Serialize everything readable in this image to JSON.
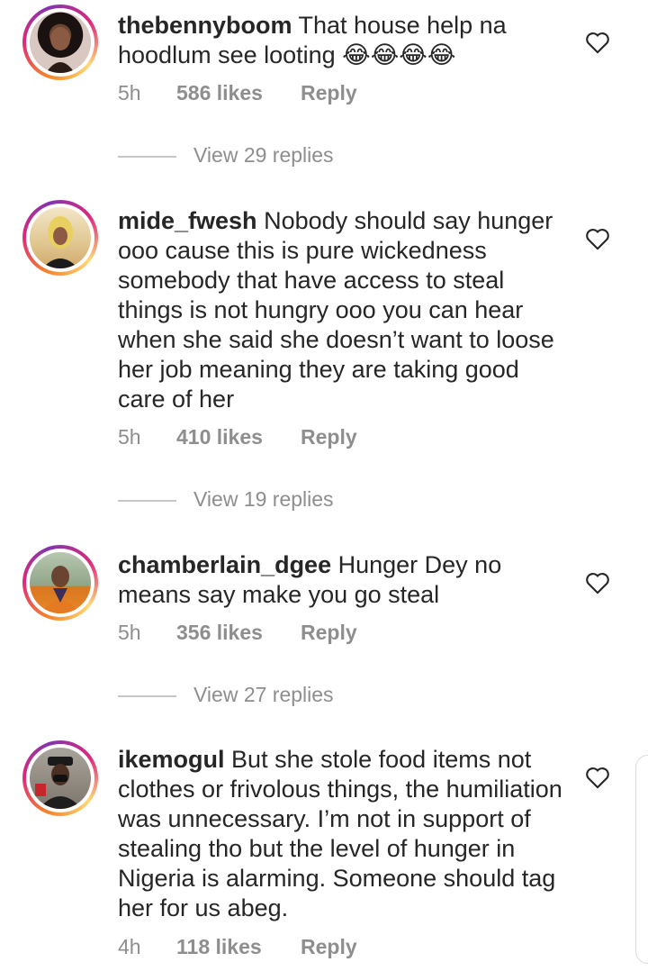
{
  "comments": [
    {
      "username": "thebennyboom",
      "text": "That house help na hoodlum see looting 😂😂😂😂",
      "time": "5h",
      "likes": "586 likes",
      "reply": "Reply",
      "view_replies": "View 29 replies"
    },
    {
      "username": "mide_fwesh",
      "text": "Nobody should say hunger ooo cause this is pure wickedness somebody that have access to steal things is not hungry ooo you can hear when she said she doesn’t want to loose her job meaning they are taking good care of her",
      "time": "5h",
      "likes": "410 likes",
      "reply": "Reply",
      "view_replies": "View 19 replies"
    },
    {
      "username": "chamberlain_dgee",
      "text": "Hunger Dey no means say make you go steal",
      "time": "5h",
      "likes": "356 likes",
      "reply": "Reply",
      "view_replies": "View 27 replies"
    },
    {
      "username": "ikemogul",
      "text": "But she stole food items not clothes or frivolous things, the humiliation was unnecessary. I’m not in support of stealing tho but the level of hunger in Nigeria is alarming. Someone should tag her for us abeg.",
      "time": "4h",
      "likes": "118 likes",
      "reply": "Reply"
    }
  ],
  "icons": {
    "like": "heart-outline-icon"
  },
  "colors": {
    "text": "#262626",
    "meta": "#8e8e8e",
    "ring_start": "#f58529",
    "ring_mid": "#dd2a7b",
    "ring_end": "#8134af"
  }
}
